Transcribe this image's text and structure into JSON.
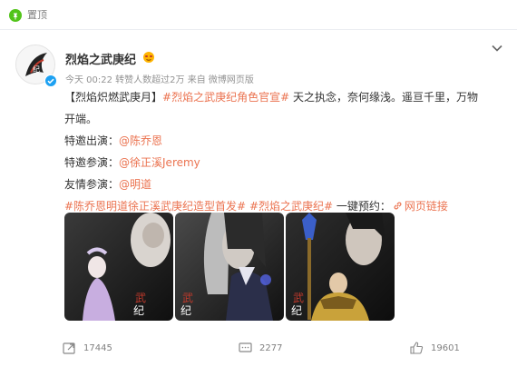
{
  "pin": {
    "label": "置顶"
  },
  "post": {
    "username": "烈焰之武庚纪",
    "meta": "今天 00:22  转赞人数超过2万  来自 微博网页版",
    "text": {
      "bracket": "【烈焰炽燃武庚月】",
      "topic1": "#烈焰之武庚纪角色官宣#",
      "line1_rest": " 天之执念，奈何缘浅。遥亘千里，万物",
      "line2": "开端。",
      "invited_label": "特邀出演：",
      "invited_name": "@陈乔恩",
      "special_label": "特邀参演：",
      "special_name": "@徐正溪Jeremy",
      "friend_label": "友情参演：",
      "friend_name": "@明道",
      "topic2": "#陈乔恩明道徐正溪武庚纪造型首发#",
      "topic3": "#烈焰之武庚纪#",
      "reserve_label": " 一键预约：",
      "web_link": "网页链接"
    },
    "images": [
      {
        "name": "poster-chen-qiaoen",
        "accent": "#b89ac9"
      },
      {
        "name": "poster-xu-zhengxi",
        "accent": "#4a4f6b"
      },
      {
        "name": "poster-ming-dao",
        "accent": "#c9a23a"
      }
    ]
  },
  "actions": {
    "repost": "17445",
    "comment": "2277",
    "like": "19601"
  },
  "colors": {
    "link": "#eb7350",
    "meta": "#939393",
    "pin": "#52c41a"
  }
}
